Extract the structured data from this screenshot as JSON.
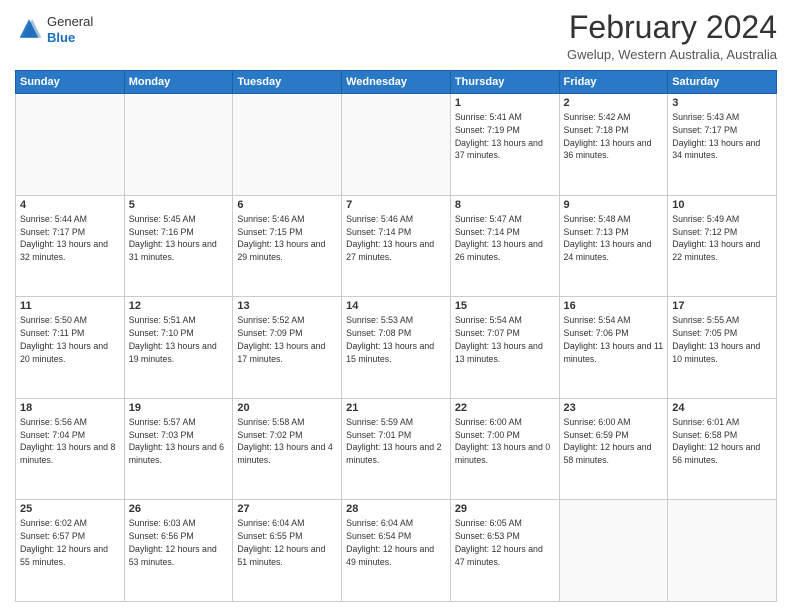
{
  "header": {
    "logo_general": "General",
    "logo_blue": "Blue",
    "month_title": "February 2024",
    "location": "Gwelup, Western Australia, Australia"
  },
  "days_of_week": [
    "Sunday",
    "Monday",
    "Tuesday",
    "Wednesday",
    "Thursday",
    "Friday",
    "Saturday"
  ],
  "weeks": [
    [
      {
        "day": "",
        "sunrise": "",
        "sunset": "",
        "daylight": ""
      },
      {
        "day": "",
        "sunrise": "",
        "sunset": "",
        "daylight": ""
      },
      {
        "day": "",
        "sunrise": "",
        "sunset": "",
        "daylight": ""
      },
      {
        "day": "",
        "sunrise": "",
        "sunset": "",
        "daylight": ""
      },
      {
        "day": "1",
        "sunrise": "Sunrise: 5:41 AM",
        "sunset": "Sunset: 7:19 PM",
        "daylight": "Daylight: 13 hours and 37 minutes."
      },
      {
        "day": "2",
        "sunrise": "Sunrise: 5:42 AM",
        "sunset": "Sunset: 7:18 PM",
        "daylight": "Daylight: 13 hours and 36 minutes."
      },
      {
        "day": "3",
        "sunrise": "Sunrise: 5:43 AM",
        "sunset": "Sunset: 7:17 PM",
        "daylight": "Daylight: 13 hours and 34 minutes."
      }
    ],
    [
      {
        "day": "4",
        "sunrise": "Sunrise: 5:44 AM",
        "sunset": "Sunset: 7:17 PM",
        "daylight": "Daylight: 13 hours and 32 minutes."
      },
      {
        "day": "5",
        "sunrise": "Sunrise: 5:45 AM",
        "sunset": "Sunset: 7:16 PM",
        "daylight": "Daylight: 13 hours and 31 minutes."
      },
      {
        "day": "6",
        "sunrise": "Sunrise: 5:46 AM",
        "sunset": "Sunset: 7:15 PM",
        "daylight": "Daylight: 13 hours and 29 minutes."
      },
      {
        "day": "7",
        "sunrise": "Sunrise: 5:46 AM",
        "sunset": "Sunset: 7:14 PM",
        "daylight": "Daylight: 13 hours and 27 minutes."
      },
      {
        "day": "8",
        "sunrise": "Sunrise: 5:47 AM",
        "sunset": "Sunset: 7:14 PM",
        "daylight": "Daylight: 13 hours and 26 minutes."
      },
      {
        "day": "9",
        "sunrise": "Sunrise: 5:48 AM",
        "sunset": "Sunset: 7:13 PM",
        "daylight": "Daylight: 13 hours and 24 minutes."
      },
      {
        "day": "10",
        "sunrise": "Sunrise: 5:49 AM",
        "sunset": "Sunset: 7:12 PM",
        "daylight": "Daylight: 13 hours and 22 minutes."
      }
    ],
    [
      {
        "day": "11",
        "sunrise": "Sunrise: 5:50 AM",
        "sunset": "Sunset: 7:11 PM",
        "daylight": "Daylight: 13 hours and 20 minutes."
      },
      {
        "day": "12",
        "sunrise": "Sunrise: 5:51 AM",
        "sunset": "Sunset: 7:10 PM",
        "daylight": "Daylight: 13 hours and 19 minutes."
      },
      {
        "day": "13",
        "sunrise": "Sunrise: 5:52 AM",
        "sunset": "Sunset: 7:09 PM",
        "daylight": "Daylight: 13 hours and 17 minutes."
      },
      {
        "day": "14",
        "sunrise": "Sunrise: 5:53 AM",
        "sunset": "Sunset: 7:08 PM",
        "daylight": "Daylight: 13 hours and 15 minutes."
      },
      {
        "day": "15",
        "sunrise": "Sunrise: 5:54 AM",
        "sunset": "Sunset: 7:07 PM",
        "daylight": "Daylight: 13 hours and 13 minutes."
      },
      {
        "day": "16",
        "sunrise": "Sunrise: 5:54 AM",
        "sunset": "Sunset: 7:06 PM",
        "daylight": "Daylight: 13 hours and 11 minutes."
      },
      {
        "day": "17",
        "sunrise": "Sunrise: 5:55 AM",
        "sunset": "Sunset: 7:05 PM",
        "daylight": "Daylight: 13 hours and 10 minutes."
      }
    ],
    [
      {
        "day": "18",
        "sunrise": "Sunrise: 5:56 AM",
        "sunset": "Sunset: 7:04 PM",
        "daylight": "Daylight: 13 hours and 8 minutes."
      },
      {
        "day": "19",
        "sunrise": "Sunrise: 5:57 AM",
        "sunset": "Sunset: 7:03 PM",
        "daylight": "Daylight: 13 hours and 6 minutes."
      },
      {
        "day": "20",
        "sunrise": "Sunrise: 5:58 AM",
        "sunset": "Sunset: 7:02 PM",
        "daylight": "Daylight: 13 hours and 4 minutes."
      },
      {
        "day": "21",
        "sunrise": "Sunrise: 5:59 AM",
        "sunset": "Sunset: 7:01 PM",
        "daylight": "Daylight: 13 hours and 2 minutes."
      },
      {
        "day": "22",
        "sunrise": "Sunrise: 6:00 AM",
        "sunset": "Sunset: 7:00 PM",
        "daylight": "Daylight: 13 hours and 0 minutes."
      },
      {
        "day": "23",
        "sunrise": "Sunrise: 6:00 AM",
        "sunset": "Sunset: 6:59 PM",
        "daylight": "Daylight: 12 hours and 58 minutes."
      },
      {
        "day": "24",
        "sunrise": "Sunrise: 6:01 AM",
        "sunset": "Sunset: 6:58 PM",
        "daylight": "Daylight: 12 hours and 56 minutes."
      }
    ],
    [
      {
        "day": "25",
        "sunrise": "Sunrise: 6:02 AM",
        "sunset": "Sunset: 6:57 PM",
        "daylight": "Daylight: 12 hours and 55 minutes."
      },
      {
        "day": "26",
        "sunrise": "Sunrise: 6:03 AM",
        "sunset": "Sunset: 6:56 PM",
        "daylight": "Daylight: 12 hours and 53 minutes."
      },
      {
        "day": "27",
        "sunrise": "Sunrise: 6:04 AM",
        "sunset": "Sunset: 6:55 PM",
        "daylight": "Daylight: 12 hours and 51 minutes."
      },
      {
        "day": "28",
        "sunrise": "Sunrise: 6:04 AM",
        "sunset": "Sunset: 6:54 PM",
        "daylight": "Daylight: 12 hours and 49 minutes."
      },
      {
        "day": "29",
        "sunrise": "Sunrise: 6:05 AM",
        "sunset": "Sunset: 6:53 PM",
        "daylight": "Daylight: 12 hours and 47 minutes."
      },
      {
        "day": "",
        "sunrise": "",
        "sunset": "",
        "daylight": ""
      },
      {
        "day": "",
        "sunrise": "",
        "sunset": "",
        "daylight": ""
      }
    ]
  ]
}
